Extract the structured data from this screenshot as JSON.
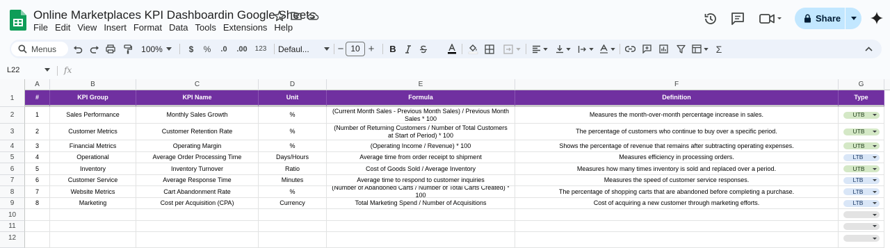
{
  "doc": {
    "title": "Online Marketplaces KPI Dashboardin Google Sheets",
    "menus": [
      "File",
      "Edit",
      "View",
      "Insert",
      "Format",
      "Data",
      "Tools",
      "Extensions",
      "Help"
    ],
    "share_label": "Share"
  },
  "toolbar": {
    "search_label": "Menus",
    "zoom": "100%",
    "currency": "$",
    "percent": "%",
    "dec_decrease": ".0",
    "dec_increase": ".00",
    "format_123": "123",
    "font_name": "Defaul...",
    "font_size": "10",
    "minus": "−",
    "plus": "+",
    "bold": "B",
    "sigma": "Σ"
  },
  "formula_bar": {
    "cell_ref": "L22",
    "fx": "fx"
  },
  "columns": [
    "A",
    "B",
    "C",
    "D",
    "E",
    "F",
    "G"
  ],
  "row_numbers": [
    "1",
    "2",
    "3",
    "4",
    "5",
    "6",
    "7",
    "8",
    "9",
    "10",
    "11",
    "12"
  ],
  "table": {
    "headers": [
      "#",
      "KPI Group",
      "KPI Name",
      "Unit",
      "Formula",
      "Definition",
      "Type"
    ],
    "rows": [
      {
        "num": "1",
        "group": "Sales Performance",
        "name": "Monthly Sales Growth",
        "unit": "%",
        "formula": "(Current Month Sales - Previous Month Sales) / Previous Month Sales * 100",
        "definition": "Measures the month-over-month percentage increase in sales.",
        "type": "UTB"
      },
      {
        "num": "2",
        "group": "Customer Metrics",
        "name": "Customer Retention Rate",
        "unit": "%",
        "formula": "(Number of Returning Customers / Number of Total Customers at Start of Period) * 100",
        "definition": "The percentage of customers who continue to buy over a specific period.",
        "type": "UTB"
      },
      {
        "num": "3",
        "group": "Financial Metrics",
        "name": "Operating Margin",
        "unit": "%",
        "formula": "(Operating Income / Revenue) * 100",
        "definition": "Shows the percentage of revenue that remains after subtracting operating expenses.",
        "type": "UTB"
      },
      {
        "num": "4",
        "group": "Operational",
        "name": "Average Order Processing Time",
        "unit": "Days/Hours",
        "formula": "Average time from order receipt to shipment",
        "definition": "Measures efficiency in processing orders.",
        "type": "LTB"
      },
      {
        "num": "5",
        "group": "Inventory",
        "name": "Inventory Turnover",
        "unit": "Ratio",
        "formula": "Cost of Goods Sold / Average Inventory",
        "definition": "Measures how many times inventory is sold and replaced over a period.",
        "type": "UTB"
      },
      {
        "num": "6",
        "group": "Customer Service",
        "name": "Average Response Time",
        "unit": "Minutes",
        "formula": "Average time to respond to customer inquiries",
        "definition": "Measures the speed of customer service responses.",
        "type": "LTB"
      },
      {
        "num": "7",
        "group": "Website Metrics",
        "name": "Cart Abandonment Rate",
        "unit": "%",
        "formula": "(Number of Abandoned Carts / Number of Total Carts Created) * 100",
        "definition": "The percentage of shopping carts that are abandoned before completing a purchase.",
        "type": "LTB"
      },
      {
        "num": "8",
        "group": "Marketing",
        "name": "Cost per Acquisition (CPA)",
        "unit": "Currency",
        "formula": "Total Marketing Spend / Number of Acquisitions",
        "definition": "Cost of acquiring a new customer through marketing efforts.",
        "type": "LTB"
      }
    ]
  },
  "colors": {
    "header_bg": "#7030a0",
    "utb_chip": "#d4e8c6",
    "ltb_chip": "#d9e6f7",
    "share_bg": "#c2e7ff",
    "logo_green": "#0f9d58"
  }
}
